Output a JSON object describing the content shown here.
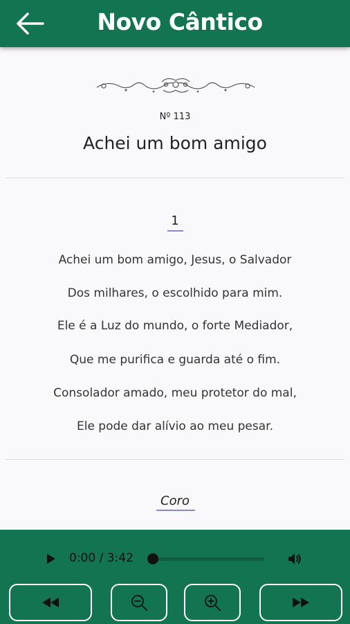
{
  "header": {
    "title": "Novo Cântico",
    "back_icon": "arrow-left-icon"
  },
  "hymn": {
    "number": "Nº 113",
    "title": "Achei um bom amigo",
    "verse_number": "1",
    "verse_lines": [
      "Achei um bom amigo, Jesus, o Salvador",
      "Dos milhares, o escolhido para mim.",
      "Ele é a Luz do mundo, o forte Mediador,",
      "Que me purifica e guarda até o fim.",
      "Consolador amado, meu protetor do mal,",
      "Ele pode dar alívio ao meu pesar."
    ],
    "chorus_label": "Coro"
  },
  "player": {
    "time": "0:00 / 3:42",
    "progress": 0
  },
  "controls": {
    "rewind": "rewind-icon",
    "zoom_out": "zoom-out-icon",
    "zoom_in": "zoom-in-icon",
    "fast_forward": "fast-forward-icon"
  },
  "colors": {
    "primary": "#137451",
    "accent_underline": "#8d87cc",
    "background": "#f9f9fb"
  }
}
